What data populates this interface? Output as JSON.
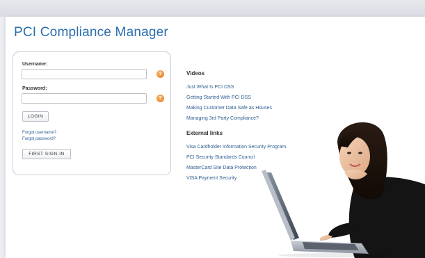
{
  "app": {
    "title": "PCI Compliance Manager"
  },
  "login": {
    "username_label": "Username:",
    "username_value": "",
    "password_label": "Password:",
    "password_value": "",
    "help_icon": "question-icon",
    "login_button": "LOGIN",
    "forgot_username": "Forgot username?",
    "forgot_password": "Forgot password?",
    "first_signin_button": "FIRST SIGN-IN"
  },
  "videos": {
    "heading": "Videos",
    "items": [
      "Just What Is PCI DSS",
      "Getting Started With PCI DSS",
      "Making Customer Data Safe as Houses",
      "Managing 3rd Party Compliance?"
    ]
  },
  "external": {
    "heading": "External links",
    "items": [
      "Visa Cardholder Information Security Program",
      "PCI Security Standards Council",
      "MasterCard Site Data Protection",
      "VISA Payment Security"
    ]
  },
  "colors": {
    "accent": "#2c6fae",
    "link": "#2f5e92",
    "help_icon": "#e07e22"
  }
}
